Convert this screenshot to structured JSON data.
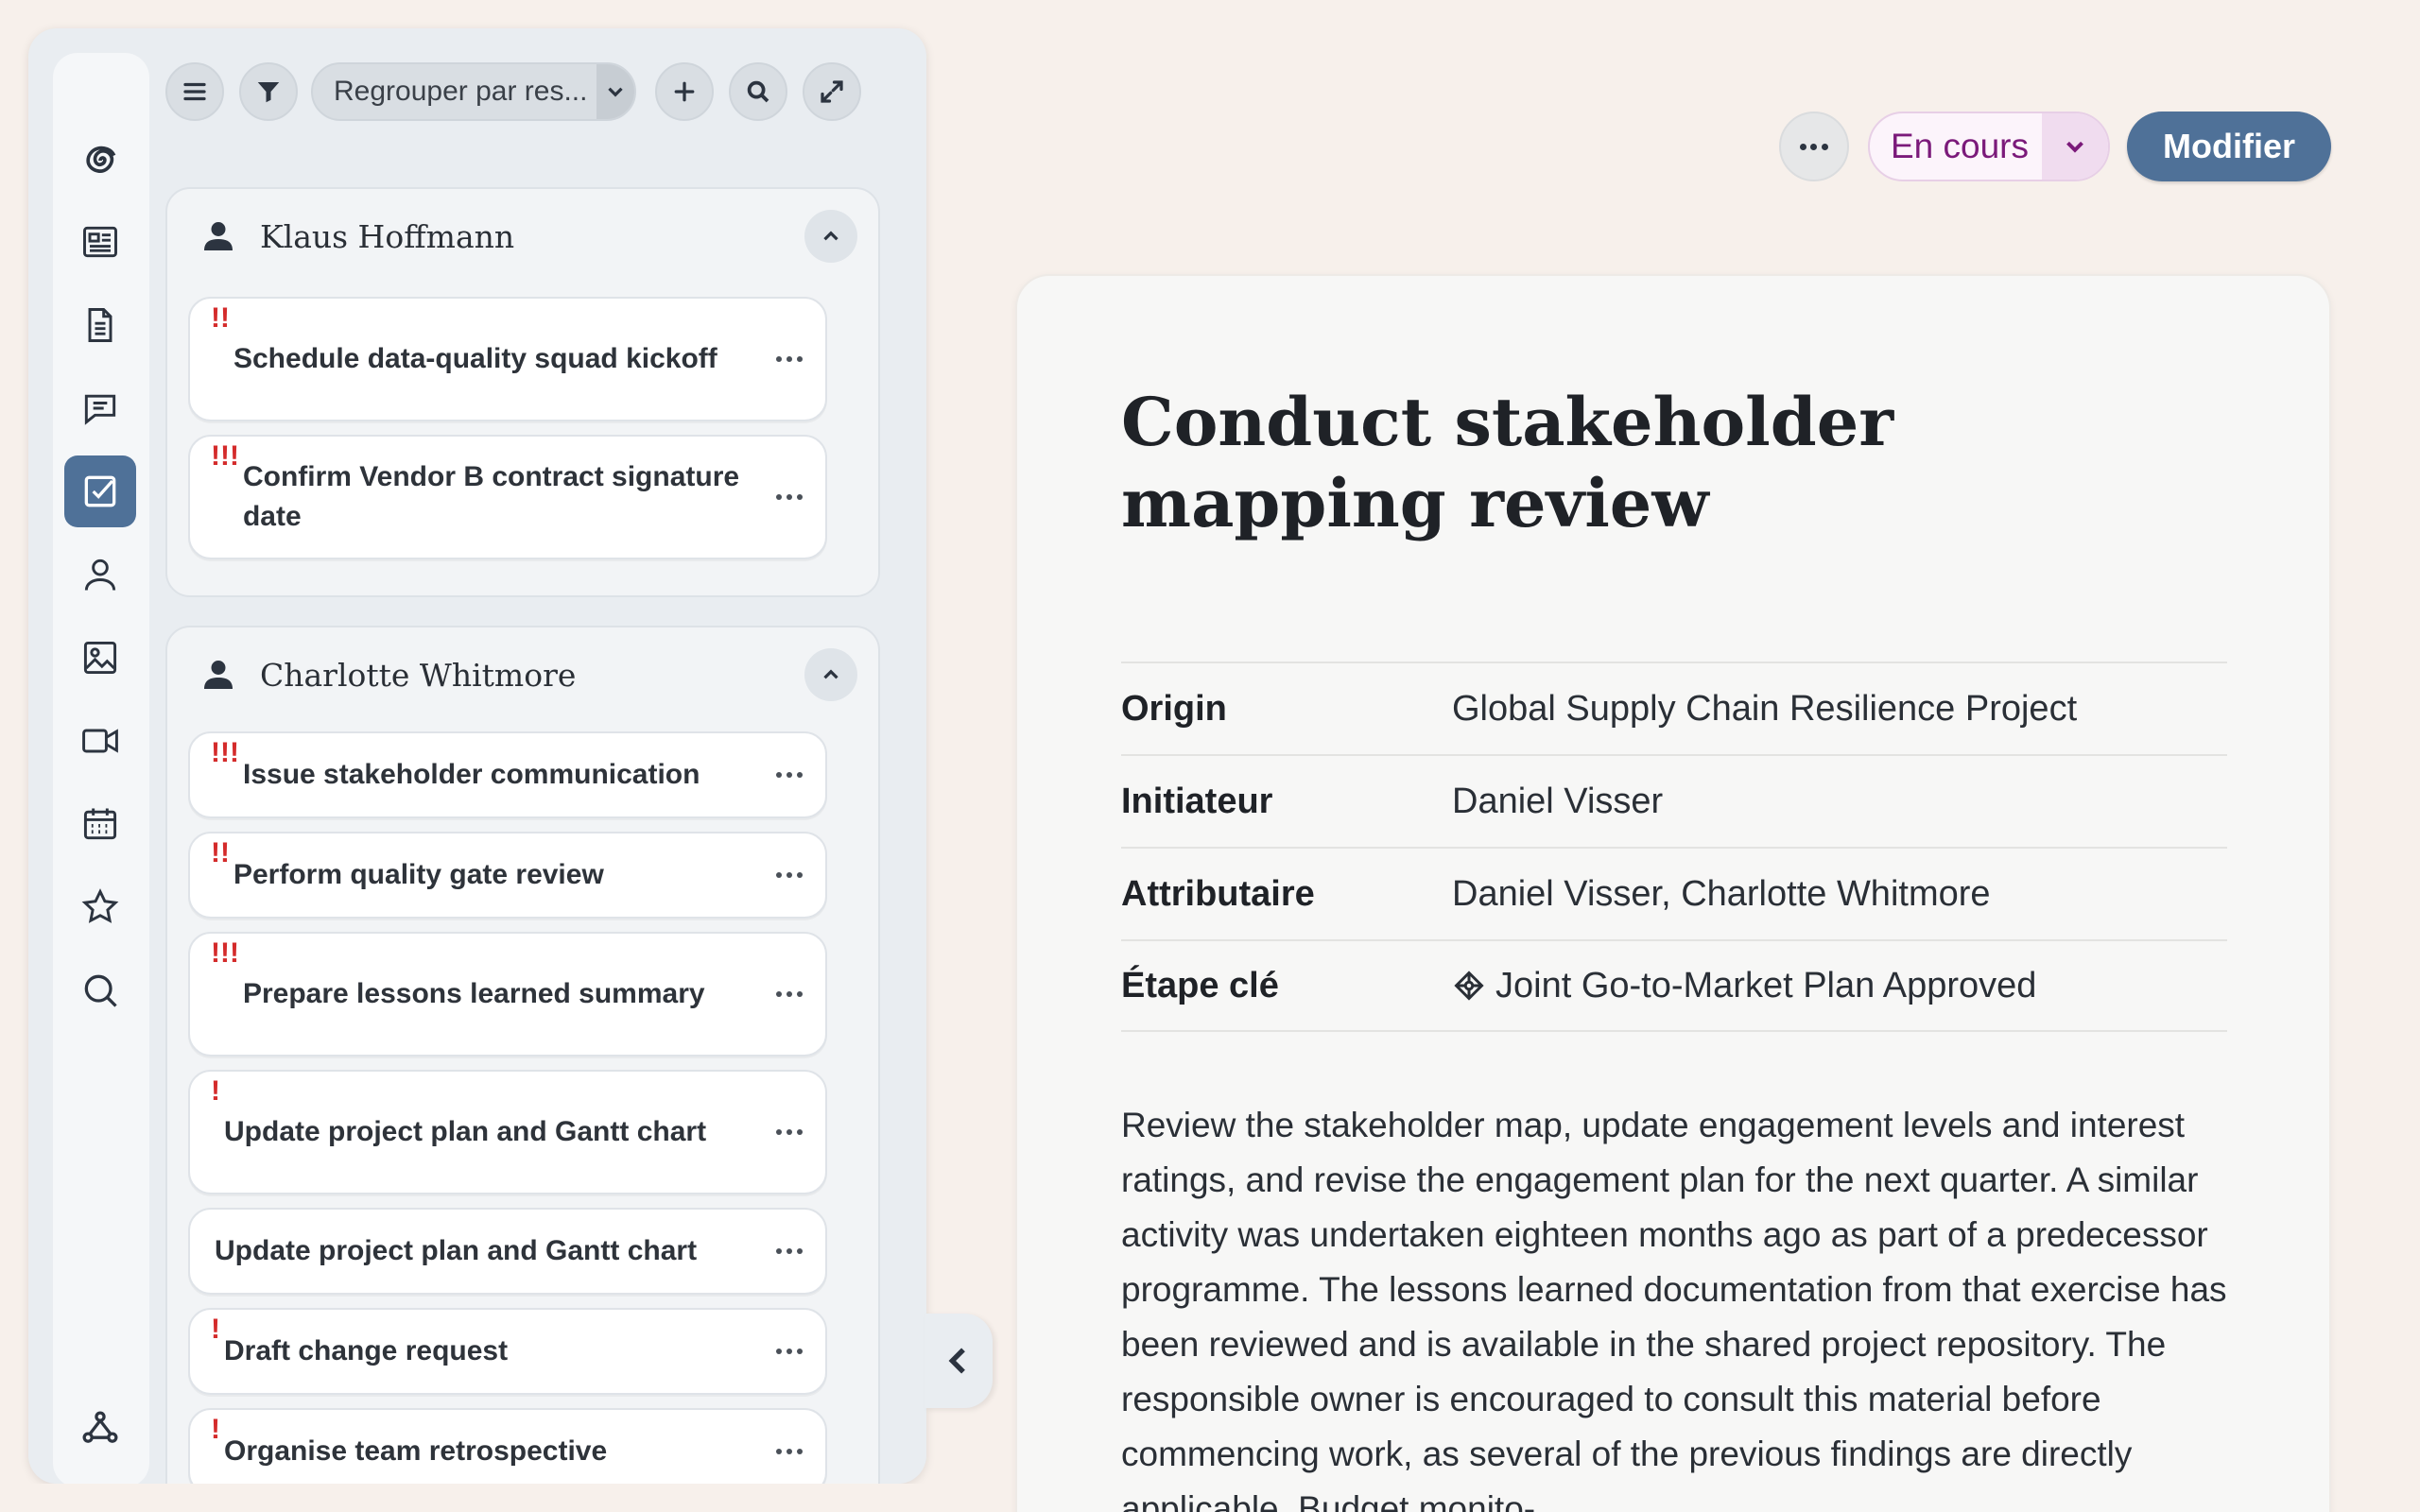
{
  "toolbar": {
    "group_by_label": "Regrouper par res..."
  },
  "groups": [
    {
      "name": "Klaus Hoffmann",
      "tasks": [
        {
          "priority": "!!",
          "title": "Schedule data-quality squad kickoff"
        },
        {
          "priority": "!!!",
          "title": "Confirm Vendor B contract signature date"
        }
      ]
    },
    {
      "name": "Charlotte Whitmore",
      "tasks": [
        {
          "priority": "!!!",
          "title": "Issue stakeholder communication"
        },
        {
          "priority": "!!",
          "title": "Perform quality gate review"
        },
        {
          "priority": "!!!",
          "title": "Prepare lessons learned summary"
        },
        {
          "priority": "!",
          "title": "Update project plan and Gantt chart"
        },
        {
          "priority": "",
          "title": "Update project plan and Gantt chart"
        },
        {
          "priority": "!",
          "title": "Draft change request"
        },
        {
          "priority": "!",
          "title": "Organise team retrospective"
        }
      ]
    }
  ],
  "header_actions": {
    "status_label": "En cours",
    "edit_label": "Modifier"
  },
  "detail": {
    "title": "Conduct stakeholder mapping review",
    "properties": [
      {
        "key": "Origin",
        "value": "Global Supply Chain Resilience Project"
      },
      {
        "key": "Initiateur",
        "value": "Daniel Visser"
      },
      {
        "key": "Attributaire",
        "value": "Daniel Visser, Charlotte Whitmore"
      },
      {
        "key": "Étape clé",
        "value": "Joint Go-to-Market Plan Approved",
        "icon": "milestone-icon"
      }
    ],
    "description": "Review the stakeholder map, update engagement levels and interest ratings, and revise the engagement plan for the next quarter. A similar activity was undertaken eighteen months ago as part of a predecessor programme. The lessons learned documentation from that exercise has been reviewed and is available in the shared project repository. The responsible owner is encouraged to consult this material before commencing work, as several of the previous findings are directly applicable. Budget monito-"
  },
  "colors": {
    "accent": "#4f7198",
    "priority": "#d42b2b",
    "status": "#7b1a7a",
    "background": "#f7f0eb"
  },
  "icons": [
    "logo-icon",
    "news-icon",
    "document-icon",
    "chat-icon",
    "tasks-icon",
    "person-icon",
    "image-icon",
    "video-icon",
    "calendar-icon",
    "star-icon",
    "search-icon",
    "settings-icon"
  ]
}
